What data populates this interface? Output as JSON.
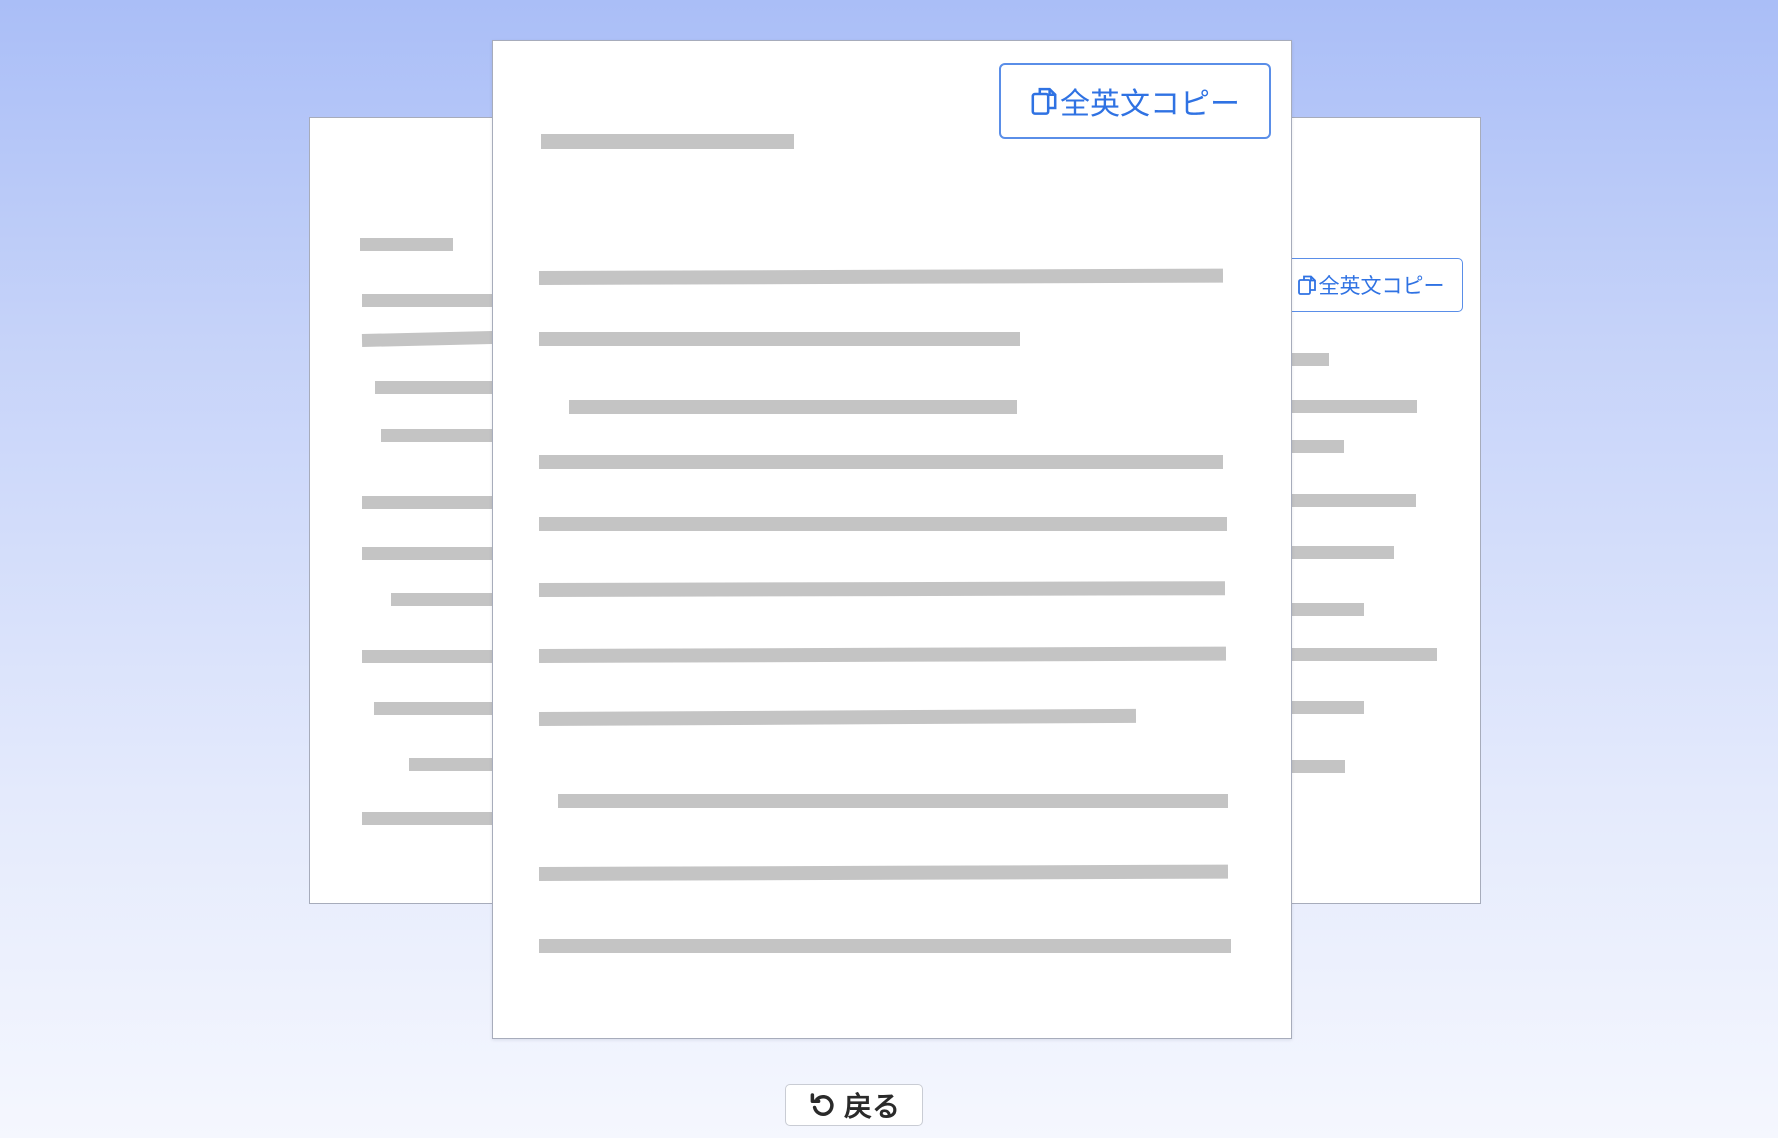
{
  "copy_all_label": "全英文コピー",
  "back_label": "戻る",
  "icons": {
    "copy": "copy-icon",
    "back": "undo-arrow-icon"
  },
  "colors": {
    "accent": "#2f72e3",
    "placeholder_line": "#c4c4c4"
  }
}
